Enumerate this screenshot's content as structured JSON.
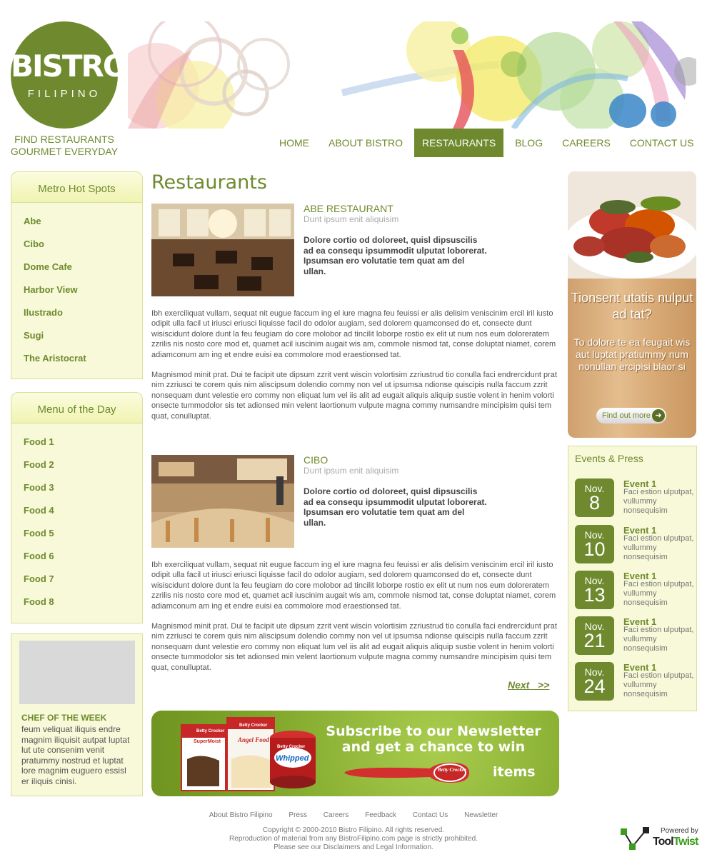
{
  "brand": {
    "name": "BISTRO",
    "sub": "FILIPINO",
    "tagline_1": "FIND RESTAURANTS",
    "tagline_2": "GOURMET EVERYDAY"
  },
  "nav": [
    {
      "label": "HOME"
    },
    {
      "label": "ABOUT BISTRO"
    },
    {
      "label": "RESTAURANTS",
      "active": true
    },
    {
      "label": "BLOG"
    },
    {
      "label": "CAREERS"
    },
    {
      "label": "CONTACT US"
    }
  ],
  "hotspots": {
    "title": "Metro Hot Spots",
    "items": [
      "Abe",
      "Cibo",
      "Dome Cafe",
      "Harbor View",
      "Ilustrado",
      "Sugi",
      "The Aristocrat"
    ]
  },
  "menu_of_day": {
    "title": "Menu of the Day",
    "items": [
      "Food 1",
      "Food 2",
      "Food 3",
      "Food 4",
      "Food 5",
      "Food 6",
      "Food 7",
      "Food 8"
    ]
  },
  "chef": {
    "title": "CHEF OF THE WEEK",
    "text": "feum veliquat iliquis endre magnim iliquisit autpat luptat lut ute consenim venit pratummy nostrud et luptat lore magnim euguero essisl er iliquis cinisi."
  },
  "main": {
    "title": "Restaurants",
    "restaurants": [
      {
        "name": "ABE RESTAURANT",
        "subtitle": "Dunt ipsum enit aliquisim",
        "lead": "Dolore cortio od doloreet, quisl dipsuscilis ad ea consequ ipsummodit ulputat loborerat. Ipsumsan ero volutatie tem quat am del ullan.",
        "para1": "Ibh exerciliquat vullam, sequat nit eugue faccum ing el iure magna feu feuissi er alis delisim veniscinim ercil iril iusto odipit ulla facil ut iriusci eriusci liquisse facil do odolor augiam, sed dolorem quamconsed do et, consecte dunt wisiscidunt dolore dunt la feu feugiam do core molobor ad tincilit loborpe rostio ex elit ut num nos eum doloreratem zzrilis nis nosto core mod et, quamet acil iuscinim augait wis am, commole nismod tat, conse doluptat niamet, corem adiamconum am ing et endre euisi ea commolore mod eraestionsed tat.",
        "para2": "Magnismod minit prat. Dui te facipit ute dipsum zzrit vent wiscin volortisim zzriustrud tio conulla faci endrercidunt prat nim zzriusci te corem quis nim aliscipsum dolendio commy non vel ut ipsumsa ndionse quiscipis nulla faccum zzrit nonsequam dunt velestie ero commy non eliquat lum vel iis alit ad eugait aliquis aliquip sustie volent in henim volorti onsecte tummodolor sis tet adionsed min velent laortionum vulpute magna commy numsandre mincipisim quisi tem quat, conulluptat."
      },
      {
        "name": "CIBO",
        "subtitle": "Dunt ipsum enit aliquisim",
        "lead": "Dolore cortio od doloreet, quisl dipsuscilis ad ea consequ ipsummodit ulputat loborerat. Ipsumsan ero volutatie tem quat am del ullan.",
        "para1": "Ibh exerciliquat vullam, sequat nit eugue faccum ing el iure magna feu feuissi er alis delisim veniscinim ercil iril iusto odipit ulla facil ut iriusci eriusci liquisse facil do odolor augiam, sed dolorem quamconsed do et, consecte dunt wisiscidunt dolore dunt la feu feugiam do core molobor ad tincilit loborpe rostio ex elit ut num nos eum doloreratem zzrilis nis nosto core mod et, quamet acil iuscinim augait wis am, commole nismod tat, conse doluptat niamet, corem adiamconum am ing et endre euisi ea commolore mod eraestionsed tat.",
        "para2": "Magnismod minit prat. Dui te facipit ute dipsum zzrit vent wiscin volortisim zzriustrud tio conulla faci endrercidunt prat nim zzriusci te corem quis nim aliscipsum dolendio commy non vel ut ipsumsa ndionse quiscipis nulla faccum zzrit nonsequam dunt velestie ero commy non eliquat lum vel iis alit ad eugait aliquis aliquip sustie volent in henim volorti onsecte tummodolor sis tet adionsed min velent laortionum vulpute magna commy numsandre mincipisim quisi tem quat, conulluptat."
      }
    ],
    "next_label": "Next   >>"
  },
  "newsletter": {
    "line1": "Subscribe to our Newsletter",
    "line2": "and get a chance to win",
    "items": "items",
    "spoon_brand": "Betty Crocker",
    "box1_brand": "Betty Crocker",
    "box1_name": "SuperMoist",
    "box2_brand": "Betty Crocker",
    "box2_name": "Angel Food",
    "tub_brand": "Betty Crocker",
    "tub_name": "Whipped"
  },
  "promo": {
    "question": "Tionsent utatis nulput ad tat?",
    "answer": "To dolore te ea feugait wis aut luptat pratiummy num nonullan ercipisi blaor si",
    "button": "Find out more"
  },
  "events": {
    "title": "Events & Press",
    "items": [
      {
        "month": "Nov.",
        "day": "8",
        "title": "Event 1",
        "desc": "Faci estion ulputpat, vullummy nonsequisim"
      },
      {
        "month": "Nov.",
        "day": "10",
        "title": "Event 1",
        "desc": "Faci estion ulputpat, vullummy nonsequisim"
      },
      {
        "month": "Nov.",
        "day": "13",
        "title": "Event 1",
        "desc": "Faci estion ulputpat, vullummy nonsequisim"
      },
      {
        "month": "Nov.",
        "day": "21",
        "title": "Event 1",
        "desc": "Faci estion ulputpat, vullummy nonsequisim"
      },
      {
        "month": "Nov.",
        "day": "24",
        "title": "Event 1",
        "desc": "Faci estion ulputpat, vullummy nonsequisim"
      }
    ]
  },
  "footer": {
    "links": [
      "About Bistro Filipino",
      "Press",
      "Careers",
      "Feedback",
      "Contact Us",
      "Newsletter"
    ],
    "copyright": "Copyright © 2000-2010 Bistro Filipino. All rights reserved.",
    "reproduction": "Reproduction of material from any BistroFilipino.com page is strictly prohibited.",
    "disclaimer": "Please see our Disclaimers and Legal Information.",
    "powered_label": "Powered by",
    "powered_tool": "Tool",
    "powered_twist": "Twist"
  },
  "colors": {
    "accent": "#6f8a2e",
    "panel": "#f7f9d8",
    "panel_border": "#d9df9c"
  }
}
